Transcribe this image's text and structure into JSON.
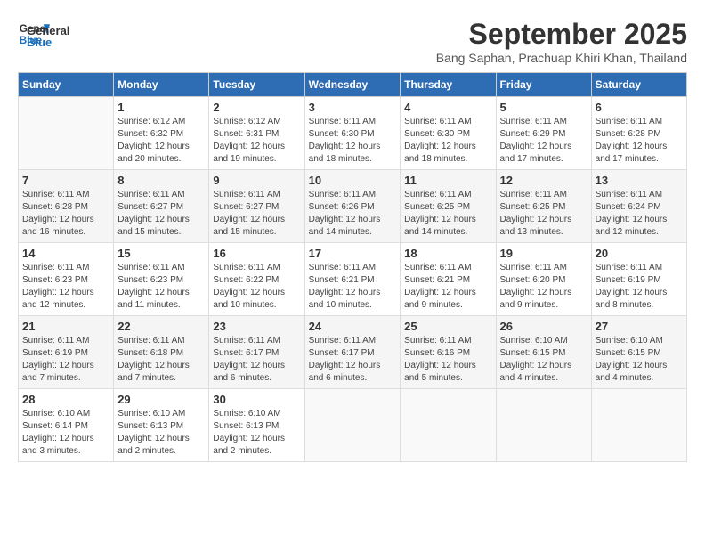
{
  "logo": {
    "line1": "General",
    "line2": "Blue"
  },
  "title": "September 2025",
  "location": "Bang Saphan, Prachuap Khiri Khan, Thailand",
  "days_of_week": [
    "Sunday",
    "Monday",
    "Tuesday",
    "Wednesday",
    "Thursday",
    "Friday",
    "Saturday"
  ],
  "weeks": [
    [
      {
        "day": "",
        "info": ""
      },
      {
        "day": "1",
        "info": "Sunrise: 6:12 AM\nSunset: 6:32 PM\nDaylight: 12 hours\nand 20 minutes."
      },
      {
        "day": "2",
        "info": "Sunrise: 6:12 AM\nSunset: 6:31 PM\nDaylight: 12 hours\nand 19 minutes."
      },
      {
        "day": "3",
        "info": "Sunrise: 6:11 AM\nSunset: 6:30 PM\nDaylight: 12 hours\nand 18 minutes."
      },
      {
        "day": "4",
        "info": "Sunrise: 6:11 AM\nSunset: 6:30 PM\nDaylight: 12 hours\nand 18 minutes."
      },
      {
        "day": "5",
        "info": "Sunrise: 6:11 AM\nSunset: 6:29 PM\nDaylight: 12 hours\nand 17 minutes."
      },
      {
        "day": "6",
        "info": "Sunrise: 6:11 AM\nSunset: 6:28 PM\nDaylight: 12 hours\nand 17 minutes."
      }
    ],
    [
      {
        "day": "7",
        "info": "Sunrise: 6:11 AM\nSunset: 6:28 PM\nDaylight: 12 hours\nand 16 minutes."
      },
      {
        "day": "8",
        "info": "Sunrise: 6:11 AM\nSunset: 6:27 PM\nDaylight: 12 hours\nand 15 minutes."
      },
      {
        "day": "9",
        "info": "Sunrise: 6:11 AM\nSunset: 6:27 PM\nDaylight: 12 hours\nand 15 minutes."
      },
      {
        "day": "10",
        "info": "Sunrise: 6:11 AM\nSunset: 6:26 PM\nDaylight: 12 hours\nand 14 minutes."
      },
      {
        "day": "11",
        "info": "Sunrise: 6:11 AM\nSunset: 6:25 PM\nDaylight: 12 hours\nand 14 minutes."
      },
      {
        "day": "12",
        "info": "Sunrise: 6:11 AM\nSunset: 6:25 PM\nDaylight: 12 hours\nand 13 minutes."
      },
      {
        "day": "13",
        "info": "Sunrise: 6:11 AM\nSunset: 6:24 PM\nDaylight: 12 hours\nand 12 minutes."
      }
    ],
    [
      {
        "day": "14",
        "info": "Sunrise: 6:11 AM\nSunset: 6:23 PM\nDaylight: 12 hours\nand 12 minutes."
      },
      {
        "day": "15",
        "info": "Sunrise: 6:11 AM\nSunset: 6:23 PM\nDaylight: 12 hours\nand 11 minutes."
      },
      {
        "day": "16",
        "info": "Sunrise: 6:11 AM\nSunset: 6:22 PM\nDaylight: 12 hours\nand 10 minutes."
      },
      {
        "day": "17",
        "info": "Sunrise: 6:11 AM\nSunset: 6:21 PM\nDaylight: 12 hours\nand 10 minutes."
      },
      {
        "day": "18",
        "info": "Sunrise: 6:11 AM\nSunset: 6:21 PM\nDaylight: 12 hours\nand 9 minutes."
      },
      {
        "day": "19",
        "info": "Sunrise: 6:11 AM\nSunset: 6:20 PM\nDaylight: 12 hours\nand 9 minutes."
      },
      {
        "day": "20",
        "info": "Sunrise: 6:11 AM\nSunset: 6:19 PM\nDaylight: 12 hours\nand 8 minutes."
      }
    ],
    [
      {
        "day": "21",
        "info": "Sunrise: 6:11 AM\nSunset: 6:19 PM\nDaylight: 12 hours\nand 7 minutes."
      },
      {
        "day": "22",
        "info": "Sunrise: 6:11 AM\nSunset: 6:18 PM\nDaylight: 12 hours\nand 7 minutes."
      },
      {
        "day": "23",
        "info": "Sunrise: 6:11 AM\nSunset: 6:17 PM\nDaylight: 12 hours\nand 6 minutes."
      },
      {
        "day": "24",
        "info": "Sunrise: 6:11 AM\nSunset: 6:17 PM\nDaylight: 12 hours\nand 6 minutes."
      },
      {
        "day": "25",
        "info": "Sunrise: 6:11 AM\nSunset: 6:16 PM\nDaylight: 12 hours\nand 5 minutes."
      },
      {
        "day": "26",
        "info": "Sunrise: 6:10 AM\nSunset: 6:15 PM\nDaylight: 12 hours\nand 4 minutes."
      },
      {
        "day": "27",
        "info": "Sunrise: 6:10 AM\nSunset: 6:15 PM\nDaylight: 12 hours\nand 4 minutes."
      }
    ],
    [
      {
        "day": "28",
        "info": "Sunrise: 6:10 AM\nSunset: 6:14 PM\nDaylight: 12 hours\nand 3 minutes."
      },
      {
        "day": "29",
        "info": "Sunrise: 6:10 AM\nSunset: 6:13 PM\nDaylight: 12 hours\nand 2 minutes."
      },
      {
        "day": "30",
        "info": "Sunrise: 6:10 AM\nSunset: 6:13 PM\nDaylight: 12 hours\nand 2 minutes."
      },
      {
        "day": "",
        "info": ""
      },
      {
        "day": "",
        "info": ""
      },
      {
        "day": "",
        "info": ""
      },
      {
        "day": "",
        "info": ""
      }
    ]
  ]
}
